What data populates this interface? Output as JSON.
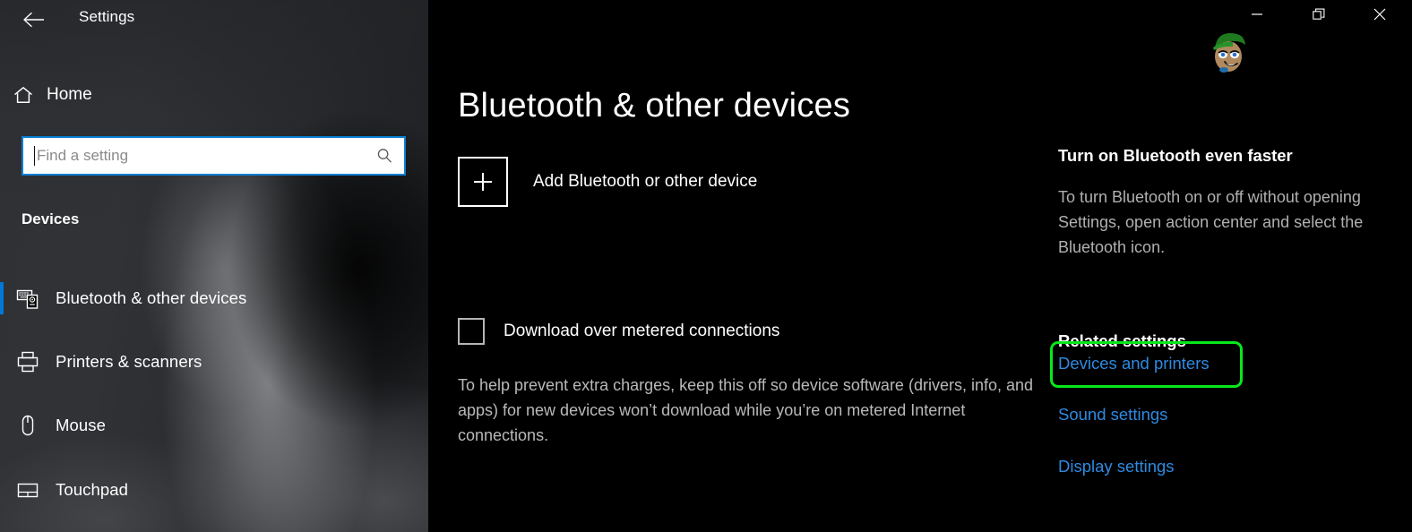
{
  "window": {
    "title": "Settings",
    "back_icon": "back-arrow-icon",
    "controls": {
      "minimize": "minimize-icon",
      "maximize": "restore-icon",
      "close": "close-icon"
    },
    "watermark": "cartoon-avatar-watermark"
  },
  "sidebar": {
    "home": {
      "label": "Home",
      "icon": "home-icon"
    },
    "search": {
      "value": "",
      "placeholder": "Find a setting",
      "icon": "search-icon"
    },
    "section_heading": "Devices",
    "items": [
      {
        "label": "Bluetooth & other devices",
        "icon": "bluetooth-devices-icon",
        "selected": true
      },
      {
        "label": "Printers & scanners",
        "icon": "printer-icon",
        "selected": false
      },
      {
        "label": "Mouse",
        "icon": "mouse-icon",
        "selected": false
      },
      {
        "label": "Touchpad",
        "icon": "touchpad-icon",
        "selected": false
      }
    ],
    "accent_color": "#0078d7"
  },
  "main": {
    "page_title": "Bluetooth & other devices",
    "add_device": {
      "label": "Add Bluetooth or other device",
      "icon": "plus-icon"
    },
    "metered": {
      "label": "Download over metered connections",
      "checked": false,
      "description": "To help prevent extra charges, keep this off so device software (drivers, info, and apps) for new devices won’t download while you’re on metered Internet connections."
    }
  },
  "right_panel": {
    "tip": {
      "title": "Turn on Bluetooth even faster",
      "body": "To turn Bluetooth on or off without opening Settings, open action center and select the Bluetooth icon."
    },
    "related_settings": {
      "heading": "Related settings",
      "links": [
        "Devices and printers",
        "Sound settings",
        "Display settings"
      ]
    },
    "link_color": "#2f8ae0"
  },
  "annotation": {
    "highlight_color": "#07e81b",
    "highlight_target": "Devices and printers"
  }
}
